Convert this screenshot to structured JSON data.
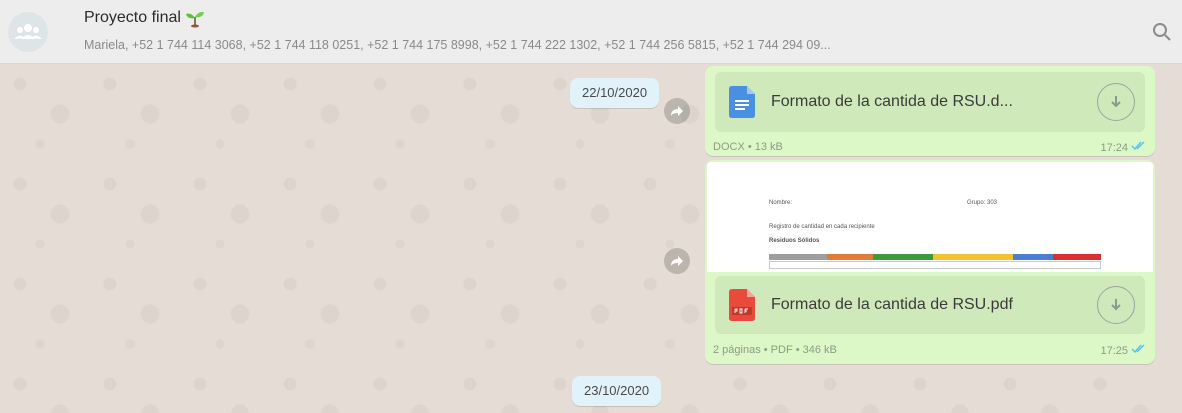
{
  "header": {
    "title": "Proyecto final",
    "participants": "Mariela, +52 1 744 114 3068, +52 1 744 118 0251, +52 1 744 175 8998, +52 1 744 222 1302, +52 1 744 256 5815, +52 1 744 294 09...",
    "avatar_icon": "group-avatar-icon",
    "title_emoji_icon": "sprout-icon",
    "search_icon": "search-icon"
  },
  "chat": {
    "date_1": "22/10/2020",
    "date_2": "23/10/2020",
    "messages": [
      {
        "file_name": "Formato de la cantida de RSU.d...",
        "meta": "DOCX • 13 kB",
        "time": "17:24",
        "file_icon": "docx-file-icon"
      },
      {
        "file_name": "Formato de la cantida de RSU.pdf",
        "meta": "2 páginas • PDF • 346 kB",
        "time": "17:25",
        "file_icon": "pdf-file-icon",
        "preview": {
          "label_left": "Nombre:",
          "label_right": "Grupo: 303",
          "line_1": "Registro de cantidad en cada recipiente",
          "line_2": "Residuos Sólidos"
        }
      }
    ]
  },
  "colors": {
    "bubble": "#dcf8c6",
    "chat_background": "#e5ddd5",
    "date_chip": "#e1f2fb",
    "read_ticks": "#4fc3f7"
  }
}
